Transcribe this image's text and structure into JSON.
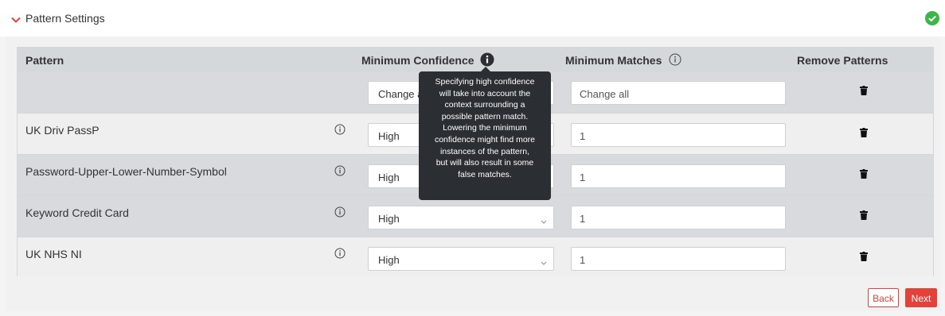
{
  "header": {
    "title": "Pattern Settings",
    "collapse_icon": "chevron-down-icon",
    "status_icon": "check-circle-icon",
    "accent_color": "#e2423a",
    "status_color": "#3cb54a"
  },
  "table": {
    "columns": {
      "pattern": "Pattern",
      "min_confidence": "Minimum Confidence",
      "min_matches": "Minimum Matches",
      "remove": "Remove Patterns"
    },
    "bulk": {
      "confidence_placeholder": "Change all",
      "matches_placeholder": "Change all"
    },
    "rows": [
      {
        "name": "UK Driv PassP",
        "confidence": "High",
        "matches": "1"
      },
      {
        "name": "Password-Upper-Lower-Number-Symbol",
        "confidence": "High",
        "matches": "1"
      },
      {
        "name": "Keyword Credit Card",
        "confidence": "High",
        "matches": "1"
      },
      {
        "name": "UK NHS NI",
        "confidence": "High",
        "matches": "1"
      }
    ]
  },
  "tooltip": {
    "lines": [
      "Specifying high confidence",
      "will take into account the",
      "context surrounding a",
      "possible pattern match.",
      "Lowering the minimum",
      "confidence might find more",
      "instances of the pattern,",
      "but will also result in some",
      "false matches."
    ]
  },
  "footer": {
    "back_label": "Back",
    "next_label": "Next"
  }
}
